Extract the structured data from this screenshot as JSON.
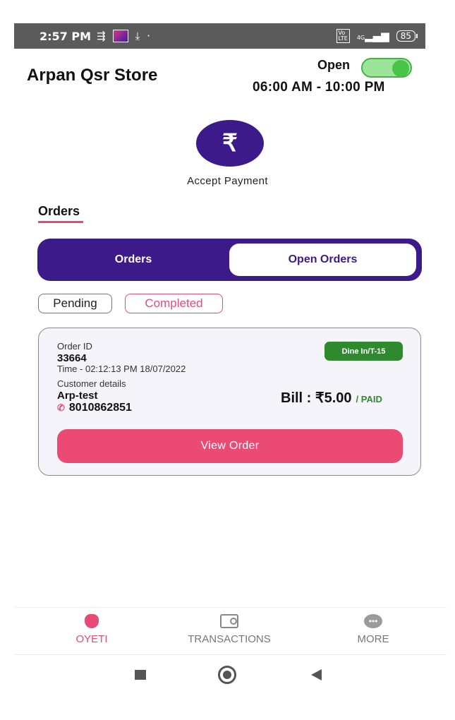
{
  "status_bar": {
    "time": "2:57 PM",
    "battery": "85",
    "network": "4G"
  },
  "header": {
    "store_name": "Arpan Qsr Store",
    "open_label": "Open",
    "open_state": true,
    "hours": "06:00 AM - 10:00 PM"
  },
  "payment": {
    "symbol": "₹",
    "label": "Accept Payment"
  },
  "orders_section": {
    "heading": "Orders",
    "tabs": [
      "Orders",
      "Open Orders"
    ],
    "active_tab": "Open Orders",
    "filters": [
      "Pending",
      "Completed"
    ],
    "active_filter": "Completed"
  },
  "order_card": {
    "order_id_label": "Order ID",
    "order_id": "33664",
    "time": "Time - 02:12:13 PM 18/07/2022",
    "customer_label": "Customer details",
    "customer_name": "Arp-test",
    "phone": "8010862851",
    "dine_badge": "Dine In/T-15",
    "bill": "Bill : ₹5.00",
    "bill_status": "/ PAID",
    "view_button": "View Order"
  },
  "bottom_nav": {
    "items": [
      {
        "label": "OYETI",
        "icon": "oyeti-icon",
        "active": true
      },
      {
        "label": "TRANSACTIONS",
        "icon": "transactions-icon",
        "active": false
      },
      {
        "label": "MORE",
        "icon": "more-icon",
        "active": false
      }
    ]
  },
  "colors": {
    "primary": "#3d1a8a",
    "accent": "#e94977",
    "success": "#2f8a2f"
  }
}
